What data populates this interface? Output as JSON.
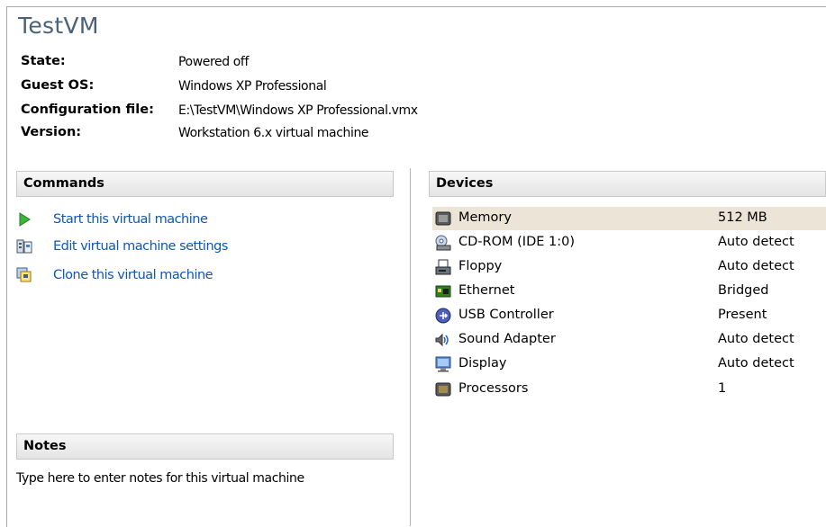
{
  "vm": {
    "title": "TestVM",
    "info": [
      {
        "label": "State:",
        "value": "Powered off"
      },
      {
        "label": "Guest OS:",
        "value": "Windows XP Professional"
      },
      {
        "label": "Configuration file:",
        "value": "E:\\TestVM\\Windows XP Professional.vmx"
      },
      {
        "label": "Version:",
        "value": "Workstation 6.x virtual machine"
      }
    ]
  },
  "commands": {
    "header": "Commands",
    "items": [
      {
        "label": "Start this virtual machine",
        "icon": "play-icon"
      },
      {
        "label": "Edit virtual machine settings",
        "icon": "settings-icon"
      },
      {
        "label": "Clone this virtual machine",
        "icon": "clone-icon"
      }
    ]
  },
  "notes": {
    "header": "Notes",
    "text": "Type here to enter notes for this virtual machine"
  },
  "devices": {
    "header": "Devices",
    "items": [
      {
        "name": "Memory",
        "value": "512 MB",
        "icon": "memory-icon",
        "selected": true
      },
      {
        "name": "CD-ROM (IDE 1:0)",
        "value": "Auto detect",
        "icon": "cdrom-icon"
      },
      {
        "name": "Floppy",
        "value": "Auto detect",
        "icon": "floppy-icon"
      },
      {
        "name": "Ethernet",
        "value": "Bridged",
        "icon": "ethernet-icon"
      },
      {
        "name": "USB Controller",
        "value": "Present",
        "icon": "usb-icon"
      },
      {
        "name": "Sound Adapter",
        "value": "Auto detect",
        "icon": "sound-icon"
      },
      {
        "name": "Display",
        "value": "Auto detect",
        "icon": "display-icon"
      },
      {
        "name": "Processors",
        "value": "1",
        "icon": "processor-icon"
      }
    ]
  },
  "colors": {
    "title": "#4b6177",
    "link": "#0c57b7",
    "selected_row": "#ece5d7",
    "header_border": "#c9c9c9"
  }
}
